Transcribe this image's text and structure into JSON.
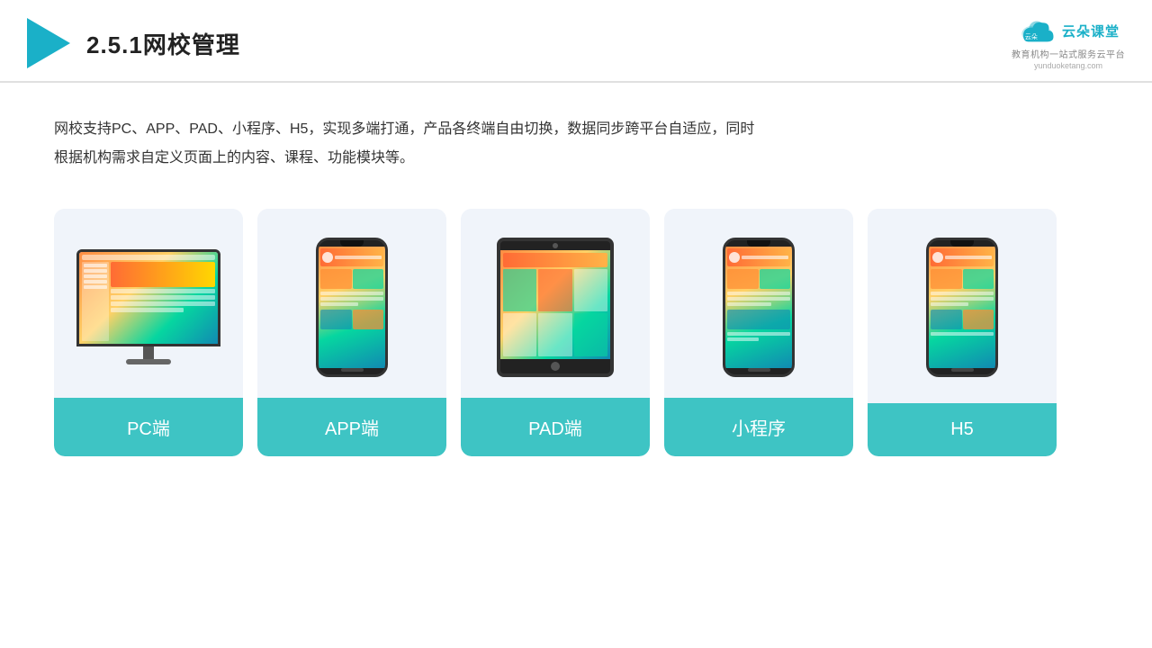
{
  "header": {
    "title": "2.5.1网校管理",
    "brand": {
      "name": "云朵课堂",
      "url": "yunduoketang.com",
      "tagline": "教育机构一站\n式服务云平台"
    }
  },
  "description": {
    "text": "网校支持PC、APP、PAD、小程序、H5，实现多端打通，产品各终端自由切换，数据同步跨平台自适应，同时根据机构需求自定义页面上的内容、课程、功能模块等。"
  },
  "cards": [
    {
      "id": "pc",
      "label": "PC端"
    },
    {
      "id": "app",
      "label": "APP端"
    },
    {
      "id": "pad",
      "label": "PAD端"
    },
    {
      "id": "miniapp",
      "label": "小程序"
    },
    {
      "id": "h5",
      "label": "H5"
    }
  ],
  "colors": {
    "teal": "#3ec4c4",
    "accent": "#1ab0c8",
    "bg_card": "#f0f4fa"
  }
}
